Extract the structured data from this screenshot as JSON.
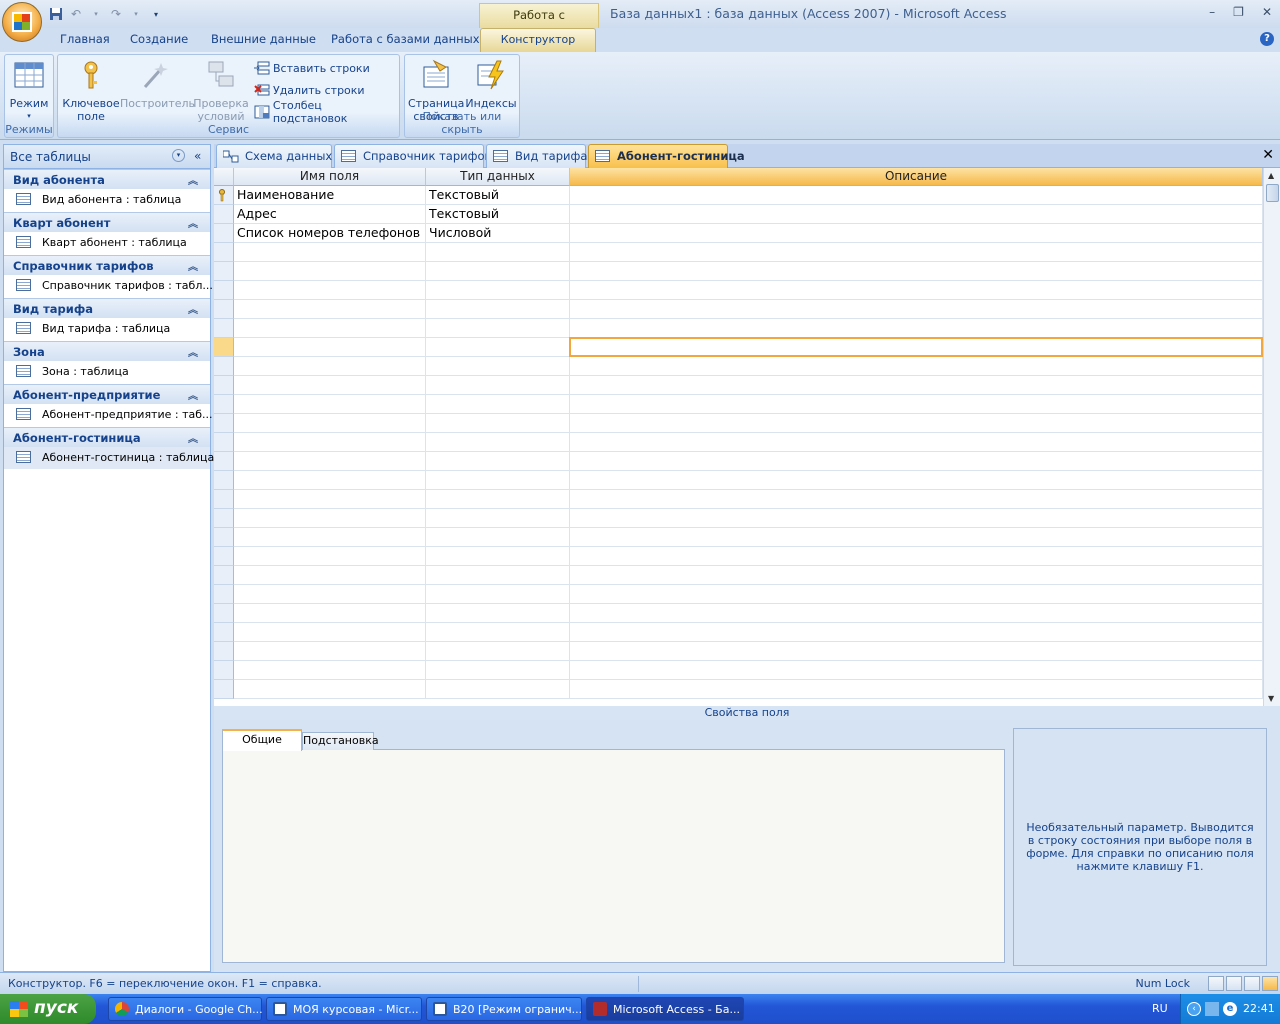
{
  "titlebar": {
    "context_tab_title": "Работа с таблицами",
    "window_title": "База данных1 : база данных (Access 2007) - Microsoft Access"
  },
  "ribbon_tabs": [
    "Главная",
    "Создание",
    "Внешние данные",
    "Работа с базами данных",
    "Конструктор"
  ],
  "ribbon": {
    "groups": {
      "modes": "Режимы",
      "service": "Сервис",
      "show_hide": "Показать или скрыть"
    },
    "buttons": {
      "mode": "Режим",
      "key_field_1": "Ключевое",
      "key_field_2": "поле",
      "builder": "Построитель",
      "validation_1": "Проверка",
      "validation_2": "условий",
      "insert_rows": "Вставить строки",
      "delete_rows": "Удалить строки",
      "lookup_column": "Столбец  подстановок",
      "property_sheet_1": "Страница",
      "property_sheet_2": "свойств",
      "indexes": "Индексы"
    }
  },
  "nav": {
    "title": "Все таблицы",
    "groups": [
      {
        "header": "Вид абонента",
        "item": "Вид абонента : таблица"
      },
      {
        "header": "Кварт абонент",
        "item": "Кварт абонент : таблица"
      },
      {
        "header": "Справочник тарифов",
        "item": "Справочник тарифов : табл..."
      },
      {
        "header": "Вид тарифа",
        "item": "Вид тарифа : таблица"
      },
      {
        "header": "Зона",
        "item": "Зона : таблица"
      },
      {
        "header": "Абонент-предприятие",
        "item": "Абонент-предприятие : таб..."
      },
      {
        "header": "Абонент-гостиница",
        "item": "Абонент-гостиница : таблица"
      }
    ]
  },
  "doc_tabs": [
    "Схема данных",
    "Справочник тарифов",
    "Вид тарифа",
    "Абонент-гостиница"
  ],
  "grid": {
    "headers": [
      "Имя поля",
      "Тип данных",
      "Описание"
    ],
    "rows": [
      {
        "name": "Наименование",
        "type": "Текстовый",
        "desc": ""
      },
      {
        "name": "Адрес",
        "type": "Текстовый",
        "desc": ""
      },
      {
        "name": "Список номеров телефонов",
        "type": "Числовой",
        "desc": ""
      }
    ]
  },
  "properties": {
    "label": "Свойства поля",
    "tabs": [
      "Общие",
      "Подстановка"
    ],
    "hint": "Необязательный параметр.  Выводится в строку состояния при выборе поля в форме.  Для справки по описанию поля нажмите клавишу F1."
  },
  "status": {
    "text": "Конструктор.  F6 = переключение окон.  F1 = справка.",
    "numlock": "Num Lock"
  },
  "taskbar": {
    "start": "пуск",
    "tasks": [
      "Диалоги - Google Ch...",
      "МОЯ курсовая - Micr...",
      "B20 [Режим огранич...",
      "Microsoft Access - Ба..."
    ],
    "lang": "RU",
    "clock": "22:41"
  },
  "colors": {
    "accent": "#f8c04b",
    "ribbon": "#d0def1",
    "taskbar": "#2256d6"
  }
}
